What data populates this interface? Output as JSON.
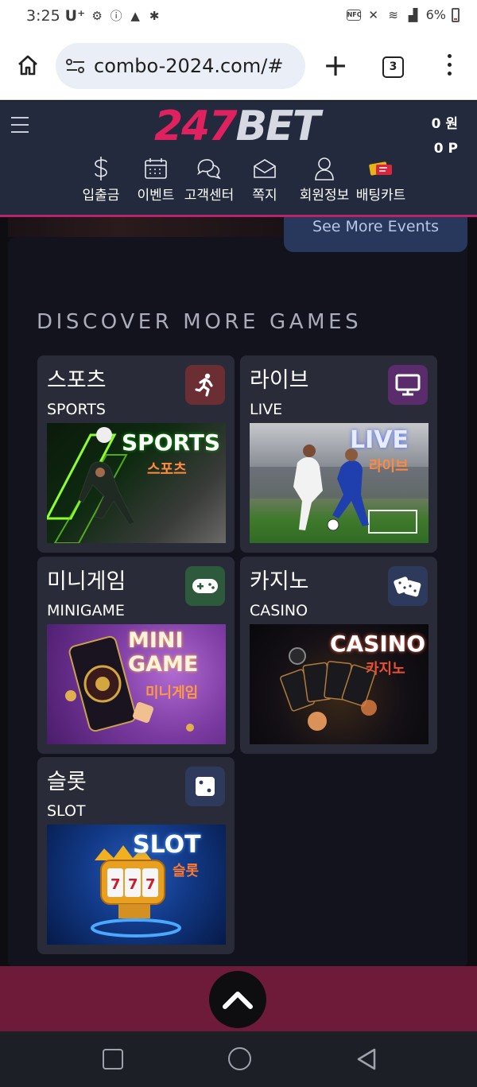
{
  "status_bar": {
    "time": "3:25",
    "carrier": "U⁺",
    "battery": "6%",
    "nfc_label": "NFC"
  },
  "browser": {
    "url": "combo-2024.com/#",
    "tab_count": "3"
  },
  "site": {
    "logo_number": "247",
    "logo_text": "BET",
    "balance_won": "0 원",
    "balance_points": "0 P",
    "nav": [
      {
        "label": "입출금",
        "icon": "dollar-icon"
      },
      {
        "label": "이벤트",
        "icon": "calendar-icon"
      },
      {
        "label": "고객센터",
        "icon": "chat-bubbles-icon"
      },
      {
        "label": "쪽지",
        "icon": "envelope-icon"
      },
      {
        "label": "회원정보",
        "icon": "user-icon"
      },
      {
        "label": "배팅카트",
        "icon": "tickets-icon"
      }
    ],
    "accent": "#b8236a"
  },
  "events": {
    "see_more_label": "See More Events"
  },
  "games": {
    "section_title": "DISCOVER MORE GAMES",
    "cards": [
      {
        "kr": "스포츠",
        "en": "SPORTS",
        "icon": "running-person-icon",
        "badge_color": "#6b2e33",
        "thumb_title": "SPORTS",
        "thumb_sub": "스포츠"
      },
      {
        "kr": "라이브",
        "en": "LIVE",
        "icon": "monitor-icon",
        "badge_color": "#5a2c6b",
        "thumb_title": "LIVE",
        "thumb_sub": "라이브"
      },
      {
        "kr": "미니게임",
        "en": "MINIGAME",
        "icon": "gamepad-icon",
        "badge_color": "#2d5a3c",
        "thumb_title": "MINI GAME",
        "thumb_sub": "미니게임"
      },
      {
        "kr": "카지노",
        "en": "CASINO",
        "icon": "dice-icon",
        "badge_color": "#2e3a5c",
        "thumb_title": "CASINO",
        "thumb_sub": "카지노"
      },
      {
        "kr": "슬롯",
        "en": "SLOT",
        "icon": "single-die-icon",
        "badge_color": "#2e3a5c",
        "thumb_title": "SLOT",
        "thumb_sub": "슬롯"
      }
    ]
  }
}
